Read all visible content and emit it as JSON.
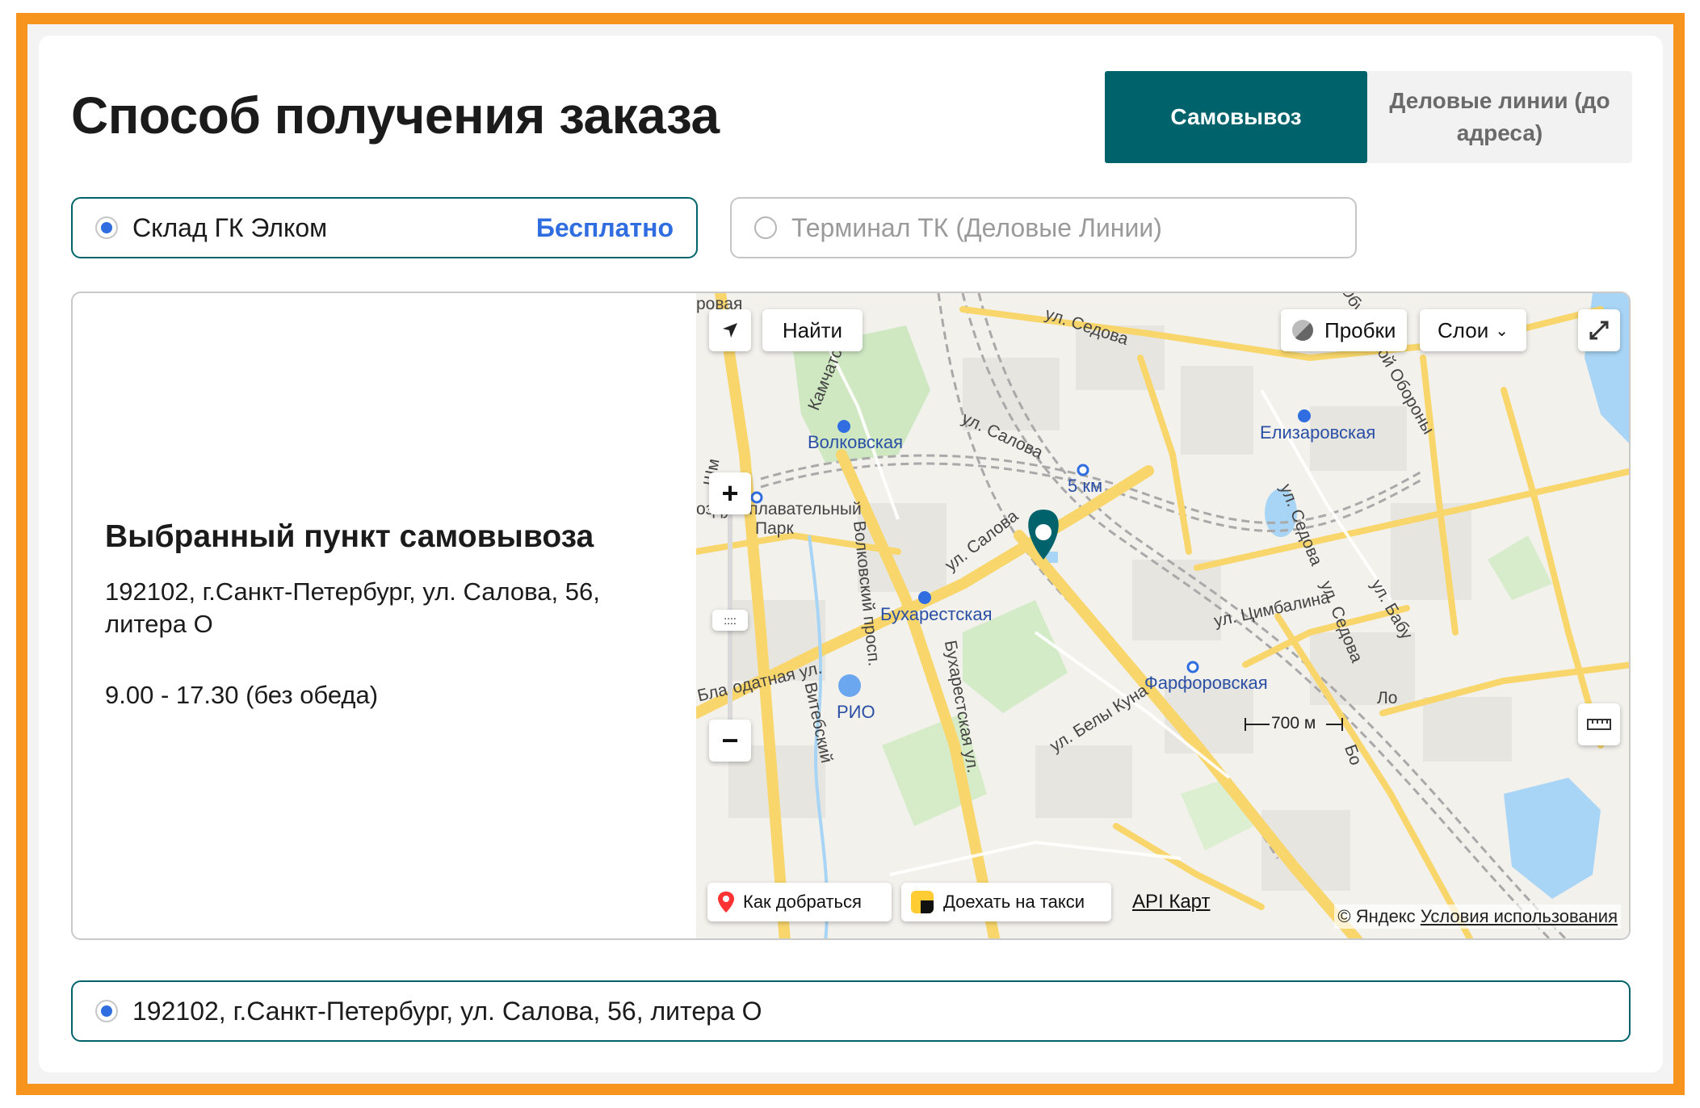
{
  "page": {
    "title": "Способ получения заказа"
  },
  "delivery_tabs": [
    {
      "label": "Самовывоз",
      "active": true
    },
    {
      "label": "Деловые линии (до адреса)",
      "active": false
    }
  ],
  "pickup_options": [
    {
      "label": "Склад ГК Элком",
      "price": "Бесплатно",
      "selected": true
    },
    {
      "label": "Терминал ТК (Деловые Линии)",
      "price": "",
      "selected": false
    }
  ],
  "point": {
    "heading": "Выбранный пункт самовывоза",
    "address": "192102, г.Санкт-Петербург, ул. Салова, 56, литера О",
    "hours": "9.00 - 17.30 (без обеда)"
  },
  "map": {
    "find_button": "Найти",
    "traffic_button": "Пробки",
    "layers_button": "Слои",
    "route_button": "Как добраться",
    "taxi_button": "Доехать на такси",
    "api_link": "API Карт",
    "copyright": "© Яндекс",
    "terms_link": "Условия использования",
    "scale": "700 м",
    "zoom_in": "+",
    "zoom_out": "−",
    "streets": {
      "sedova_top": "ул. Седова",
      "salova_top": "ул. Салова",
      "salova_mid": "ул. Салова",
      "kamchatskaya": "Камчатская",
      "volkovsky": "Волковский просп.",
      "buharestskaya_st": "Бухарестская ул.",
      "blagodatnaya": "Благодатная ул.",
      "vitebsky": "Витебский",
      "belykuna": "ул. Белы Куна",
      "tsimbalina": "ул. Цимбалина",
      "sedova_right": "ул. Седова",
      "sedova_right2": "ул. Седова",
      "obukhovskoy": "Обуховской Обороны",
      "shm": "Шм",
      "vozd": "оздухоплавательный",
      "park": "Парк",
      "rovaya": "ровая",
      "babush": "ул. Бабу",
      "lo": "Ло",
      "bo": "Бо",
      "rio": "РИО"
    },
    "metro": {
      "volkovskaya": "Волковская",
      "elizarovskaya": "Елизаровская",
      "bukharestskaya": "Бухарестская",
      "km5": "5 км",
      "farforovskaya": "Фарфоровская"
    }
  },
  "address_option": {
    "label": "192102, г.Санкт-Петербург, ул. Салова, 56, литера О",
    "selected": true
  },
  "colors": {
    "accent": "#00636b",
    "frame": "#f7941d",
    "link_blue": "#2f6de1",
    "radio_blue": "#2f6de1"
  }
}
